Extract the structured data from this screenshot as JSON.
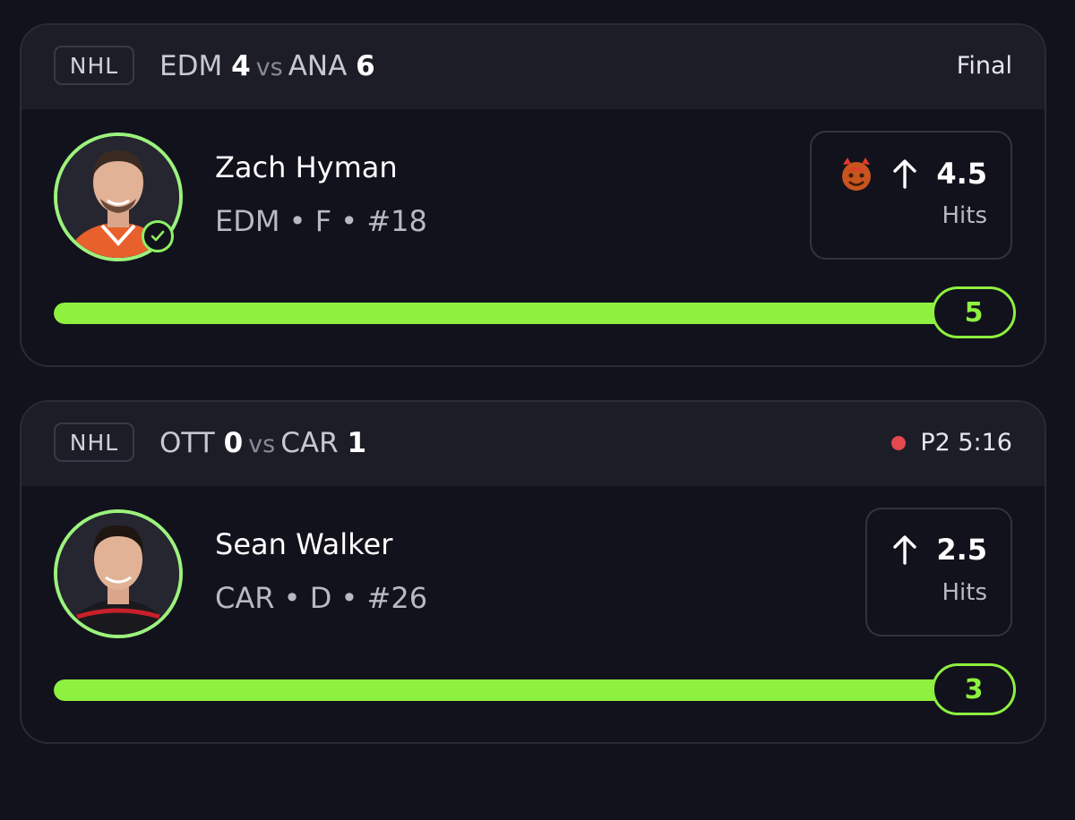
{
  "cards": [
    {
      "league": "NHL",
      "away_team": "EDM",
      "away_score": "4",
      "vs": "vs",
      "home_team": "ANA",
      "home_score": "6",
      "status": "Final",
      "player": {
        "name": "Zach Hyman",
        "info": "EDM • F • #18",
        "hit_check": true
      },
      "line": {
        "value": "4.5",
        "stat": "Hits",
        "direction": "over",
        "icon": "devil-emoji-icon"
      },
      "result": {
        "value": "5",
        "progress": 1.0
      }
    },
    {
      "league": "NHL",
      "away_team": "OTT",
      "away_score": "0",
      "vs": "vs",
      "home_team": "CAR",
      "home_score": "1",
      "status": "P2 5:16",
      "live": true,
      "player": {
        "name": "Sean Walker",
        "info": "CAR • D • #26",
        "hit_check": false
      },
      "line": {
        "value": "2.5",
        "stat": "Hits",
        "direction": "over"
      },
      "result": {
        "value": "3",
        "progress": 1.0
      }
    }
  ],
  "colors": {
    "accent": "#8ef03f",
    "background": "#12121c",
    "header": "#1d1d27",
    "live": "#e5484d"
  }
}
